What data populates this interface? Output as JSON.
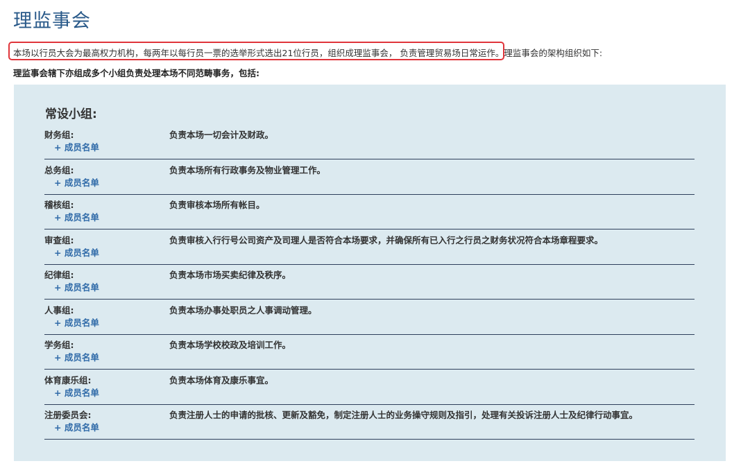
{
  "page": {
    "title": "理监事会",
    "intro_highlighted": "本场以行员大会为最高权力机构，每两年以每行员一票的选举形式选出21位行员，组织成理监事会， 负责管理贸易场日常运作。",
    "intro_rest": "理监事会的架构组织如下:",
    "subhead": "理监事会辖下亦组成多个小组负责处理本场不同范畴事务，包括:"
  },
  "panel": {
    "title": "常设小组:",
    "members_label": "+ 成员名单",
    "groups": [
      {
        "name": "财务组:",
        "desc": "负责本场一切会计及财政。"
      },
      {
        "name": "总务组:",
        "desc": "负责本场所有行政事务及物业管理工作。"
      },
      {
        "name": "稽核组:",
        "desc": "负责审核本场所有帐目。"
      },
      {
        "name": "审查组:",
        "desc": "负责审核入行行号公司资产及司理人是否符合本场要求，并确保所有已入行之行员之财务状况符合本场章程要求。"
      },
      {
        "name": "纪律组:",
        "desc": "负责本场市场买卖纪律及秩序。"
      },
      {
        "name": "人事组:",
        "desc": "负责本场办事处职员之人事调动管理。"
      },
      {
        "name": "学务组:",
        "desc": "负责本场学校校政及培训工作。"
      },
      {
        "name": "体育康乐组:",
        "desc": "负责本场体育及康乐事宜。"
      },
      {
        "name": "注册委员会:",
        "desc": "负责注册人士的申请的批核、更新及豁免，制定注册人士的业务操守规则及指引，处理有关投诉注册人士及纪律行动事宜。"
      }
    ]
  },
  "colors": {
    "title": "#2a5a8a",
    "panel_bg": "#dceaf0",
    "link": "#2f6aa8",
    "highlight_border": "#e0343a"
  }
}
